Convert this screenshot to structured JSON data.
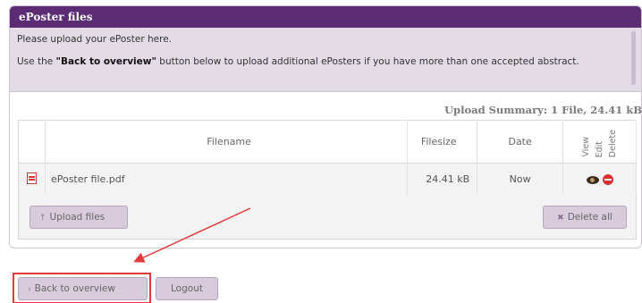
{
  "panel": {
    "title": "ePoster files",
    "info_line1": "Please upload your ePoster here.",
    "info_line2_pre": "Use the ",
    "info_line2_bold": "\"Back to overview\"",
    "info_line2_post": " button below to upload additional ePosters if you have more than one accepted abstract."
  },
  "summary": "Upload Summary: 1 File, 24.41 kB",
  "table": {
    "headers": {
      "filename": "Filename",
      "filesize": "Filesize",
      "date": "Date",
      "view": "View",
      "edit": "Edit",
      "delete": "Delete"
    },
    "rows": [
      {
        "filename": "ePoster file.pdf",
        "filesize": "24.41 kB",
        "date": "Now"
      }
    ]
  },
  "buttons": {
    "upload": "Upload files",
    "delete_all": "Delete all",
    "back": "Back to overview",
    "logout": "Logout"
  },
  "icons": {
    "file": "pdf-icon",
    "view": "eye-icon",
    "delete": "delete-icon",
    "upload": "upload-arrow-icon",
    "delete_all": "x-icon",
    "back": "back-arrow-icon"
  },
  "colors": {
    "header_bg": "#5b2c73",
    "info_bg": "#e3dbe6",
    "button_bg": "#d8cbdc",
    "annotation": "#e23a3a"
  }
}
